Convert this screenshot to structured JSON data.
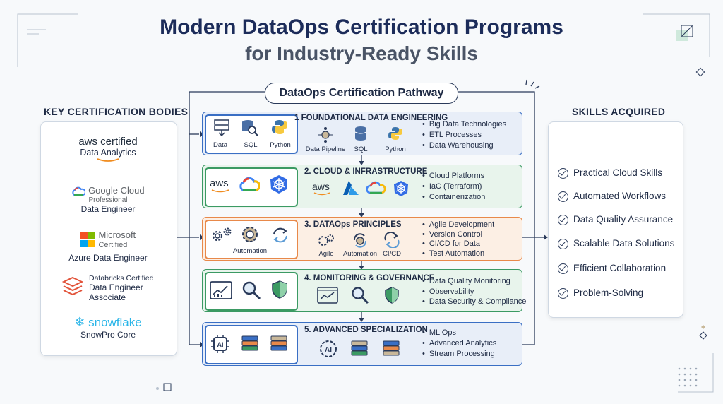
{
  "title": {
    "line1": "Modern DataOps Certification Programs",
    "line2": "for Industry-Ready Skills"
  },
  "left": {
    "heading": "KEY CERTIFICATION BODIES",
    "certs": [
      {
        "logo": "aws certified",
        "name": "Data Analytics"
      },
      {
        "logo": "Google Cloud",
        "sub": "Professional",
        "name": "Data Engineer"
      },
      {
        "logo": "Microsoft",
        "sub": "Certified",
        "name": "Azure Data Engineer"
      },
      {
        "logo": "Databricks Certified",
        "name": "Data Engineer Associate"
      },
      {
        "logo": "snowflake",
        "name": "SnowPro Core"
      }
    ]
  },
  "right": {
    "heading": "SKILLS ACQUIRED",
    "skills": [
      "Practical Cloud Skills",
      "Automated Workflows",
      "Data Quality Assurance",
      "Scalable Data Solutions",
      "Efficient Collaboration",
      "Problem-Solving"
    ]
  },
  "pathway": {
    "title": "DataOps Certification Pathway",
    "steps": [
      {
        "title": "1 FOUNDATIONAL DATA ENGINEERING",
        "left_labels": [
          "Data",
          "SQL",
          "Python"
        ],
        "mid_labels": [
          "Data Pipeline",
          "SQL",
          "Python"
        ],
        "bullets": [
          "Big Data Technologies",
          "ETL Processes",
          "Data Warehousing"
        ],
        "color": "#3a6fc4"
      },
      {
        "title": "2. CLOUD & INFRASTRUCTURE",
        "left_labels": [
          "aws",
          "",
          ""
        ],
        "mid_labels": [
          "aws",
          "",
          "",
          ""
        ],
        "bullets": [
          "Cloud Platforms",
          "IaC (Terraform)",
          "Containerization"
        ],
        "color": "#3b9a63"
      },
      {
        "title": "3. DATAOps PRINCIPLES",
        "left_labels": [
          "Automation"
        ],
        "mid_labels": [
          "Agile",
          "Automation",
          "CI/CD"
        ],
        "bullets": [
          "Agile Development",
          "Version Control",
          "CI/CD for Data",
          "Test Automation"
        ],
        "color": "#e8894a"
      },
      {
        "title": "4. MONITORING & GOVERNANCE",
        "left_labels": [],
        "mid_labels": [],
        "bullets": [
          "Data Quality Monitoring",
          "Observability",
          "Data Security & Compliance"
        ],
        "color": "#3b9a63"
      },
      {
        "title": "5. ADVANCED SPECIALIZATION",
        "left_labels": [],
        "mid_labels": [],
        "bullets": [
          "ML Ops",
          "Advanced Analytics",
          "Stream Processing"
        ],
        "color": "#3a6fc4"
      }
    ],
    "ai_label": "AI"
  }
}
